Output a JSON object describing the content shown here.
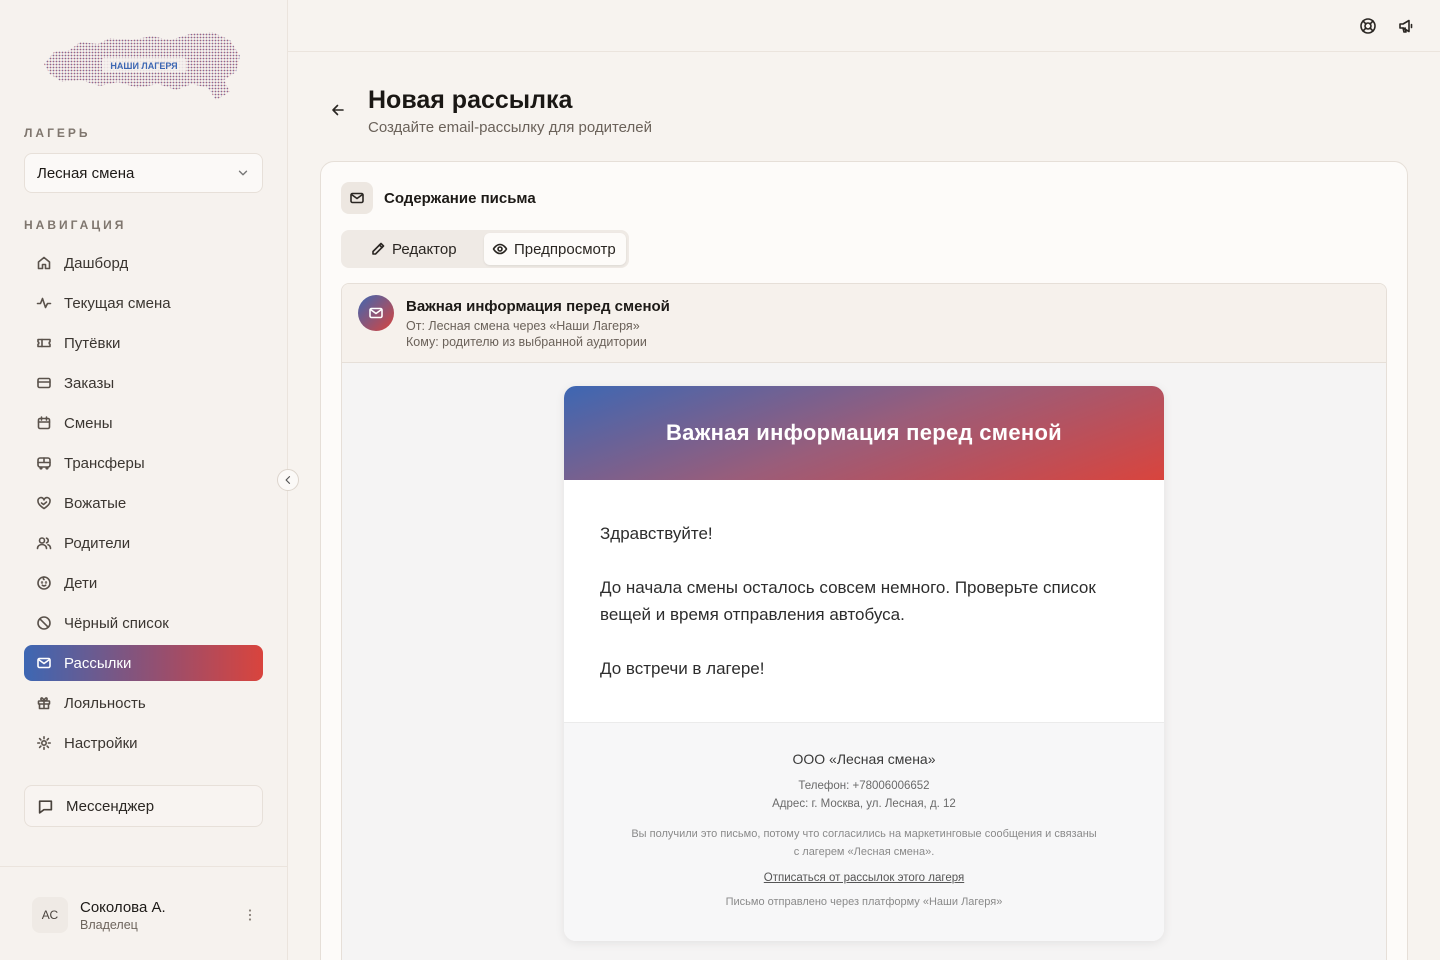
{
  "brand": {
    "logo_text": "НАШИ ЛАГЕРЯ",
    "colors": {
      "blue": "#3d67b3",
      "red": "#d9443d"
    }
  },
  "sidebar": {
    "camp_label": "ЛАГЕРЬ",
    "camp_value": "Лесная смена",
    "nav_label": "НАВИГАЦИЯ",
    "items": [
      {
        "label": "Дашборд",
        "icon": "home-icon"
      },
      {
        "label": "Текущая смена",
        "icon": "activity-icon"
      },
      {
        "label": "Путёвки",
        "icon": "ticket-icon"
      },
      {
        "label": "Заказы",
        "icon": "credit-card-icon"
      },
      {
        "label": "Смены",
        "icon": "calendar-icon"
      },
      {
        "label": "Трансферы",
        "icon": "bus-icon"
      },
      {
        "label": "Вожатые",
        "icon": "heart-hand-icon"
      },
      {
        "label": "Родители",
        "icon": "users-icon"
      },
      {
        "label": "Дети",
        "icon": "baby-icon"
      },
      {
        "label": "Чёрный список",
        "icon": "ban-icon"
      },
      {
        "label": "Рассылки",
        "icon": "mail-icon",
        "active": true
      },
      {
        "label": "Лояльность",
        "icon": "gift-icon"
      },
      {
        "label": "Настройки",
        "icon": "settings-icon"
      }
    ],
    "messenger_label": "Мессенджер",
    "user": {
      "initials": "АС",
      "name": "Соколова А.",
      "role": "Владелец"
    }
  },
  "header": {
    "title": "Новая рассылка",
    "subtitle": "Создайте email-рассылку для родителей"
  },
  "card": {
    "title": "Содержание письма",
    "tabs": [
      {
        "label": "Редактор",
        "icon": "pencil-icon"
      },
      {
        "label": "Предпросмотр",
        "icon": "eye-icon",
        "active": true
      }
    ]
  },
  "preview": {
    "subject": "Важная информация перед сменой",
    "from": "От: Лесная смена через «Наши Лагеря»",
    "to": "Кому: родителю из выбранной аудитории",
    "email": {
      "hero_title": "Важная информация перед сменой",
      "greeting": "Здравствуйте!",
      "body": "До начала смены осталось совсем немного. Проверьте список вещей и время отправления автобуса.",
      "closing": "До встречи в лагере!",
      "footer": {
        "company": "ООО «Лесная смена»",
        "phone": "Телефон: +78006006652",
        "address": "Адрес: г. Москва, ул. Лесная, д. 12",
        "notice_line1": "Вы получили это письмо, потому что согласились на маркетинговые сообщения и связаны",
        "notice_line2": "с лагерем «Лесная смена».",
        "unsubscribe": "Отписаться от рассылок этого лагеря",
        "platform": "Письмо отправлено через платформу «Наши Лагеря»"
      }
    }
  }
}
